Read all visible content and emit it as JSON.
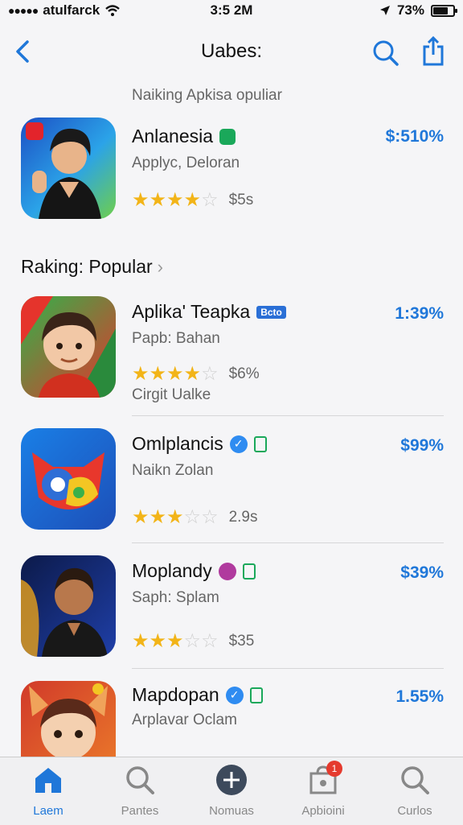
{
  "status_bar": {
    "carrier": "atulfarck",
    "time": "3:5 2M",
    "battery": "73%",
    "battery_level": 0.73
  },
  "nav": {
    "title": "Uabes:",
    "back_icon": "chevron-left-icon",
    "search_icon": "search-icon",
    "share_icon": "share-icon"
  },
  "featured": {
    "section_label": "Naiking Apkisa opuliar",
    "name": "Anlanesia",
    "subtitle": "Applyc, Deloran",
    "price": "$:510%",
    "stars": 4,
    "rating_count": "$5s"
  },
  "ranking": {
    "header": "Raking: Popular",
    "apps": [
      {
        "name": "Aplika' Teapka",
        "tag": "Bcto",
        "subtitle": "Papb: Bahan",
        "price": "1:39%",
        "stars": 4,
        "rating_count": "$6%",
        "extra": "Cirgit Ualke"
      },
      {
        "name": "Omlplancis",
        "tag": "",
        "subtitle": "Naikn Zolan",
        "price": "$99%",
        "stars": 3,
        "rating_count": "2.9s",
        "extra": ""
      },
      {
        "name": "Moplandy",
        "tag": "",
        "subtitle": "Saph: Splam",
        "price": "$39%",
        "stars": 3,
        "rating_count": "$35",
        "extra": ""
      },
      {
        "name": "Mapdopan",
        "tag": "",
        "subtitle": "Arplavar Oclam",
        "price": "1.55%",
        "stars": 0,
        "rating_count": "",
        "extra": ""
      }
    ]
  },
  "tabs": [
    {
      "label": "Laem",
      "icon": "home-icon",
      "active": true
    },
    {
      "label": "Pantes",
      "icon": "search-icon",
      "active": false
    },
    {
      "label": "Nomuas",
      "icon": "plus-circle-icon",
      "active": false
    },
    {
      "label": "Apbioini",
      "icon": "bag-icon",
      "active": false,
      "badge": "1"
    },
    {
      "label": "Curlos",
      "icon": "search-icon",
      "active": false
    }
  ],
  "colors": {
    "accent": "#1f77d9",
    "star": "#f2b418",
    "badge_red": "#e53a2e"
  }
}
